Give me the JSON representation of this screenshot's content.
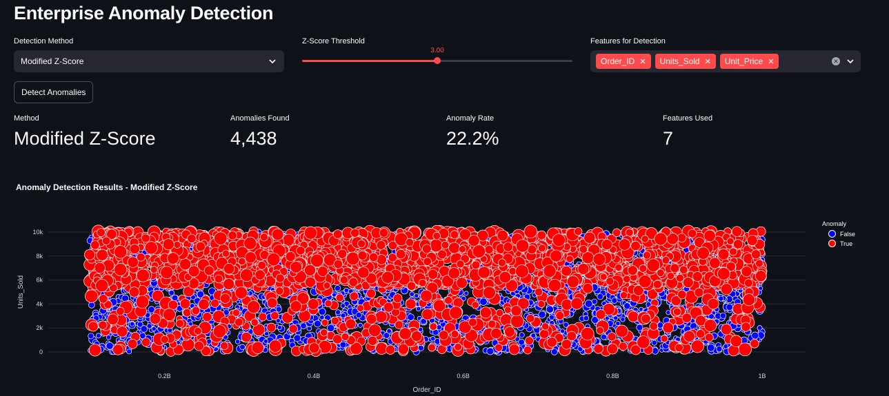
{
  "app": {
    "title": "Enterprise Anomaly Detection"
  },
  "controls": {
    "method_label": "Detection Method",
    "method_value": "Modified Z-Score",
    "threshold_label": "Z-Score Threshold",
    "threshold_value": "3.00",
    "threshold_fraction": 0.5,
    "features_label": "Features for Detection",
    "features": [
      "Order_ID",
      "Unit_Price",
      "Units_Sold"
    ],
    "features_shown": [
      "Order_ID",
      "Units_Sold",
      "Unit_Price"
    ],
    "detect_button": "Detect Anomalies"
  },
  "metrics": [
    {
      "label": "Method",
      "value": "Modified Z-Score"
    },
    {
      "label": "Anomalies Found",
      "value": "4,438"
    },
    {
      "label": "Anomaly Rate",
      "value": "22.2%"
    },
    {
      "label": "Features Used",
      "value": "7"
    }
  ],
  "colors": {
    "accent": "#ff4b4b",
    "false_color": "#0000ff",
    "true_color": "#ff0000",
    "background": "#0e1117"
  },
  "chart_data": {
    "type": "scatter",
    "title": "Anomaly Detection Results - Modified Z-Score",
    "xlabel": "Order_ID",
    "ylabel": "Units_Sold",
    "xlim": [
      100000000,
      1000000000
    ],
    "ylim": [
      0,
      10000
    ],
    "x_ticks": [
      {
        "value": 200000000,
        "label": "0.2B"
      },
      {
        "value": 400000000,
        "label": "0.4B"
      },
      {
        "value": 600000000,
        "label": "0.6B"
      },
      {
        "value": 800000000,
        "label": "0.8B"
      },
      {
        "value": 1000000000,
        "label": "1B"
      }
    ],
    "y_ticks": [
      {
        "value": 0,
        "label": "0"
      },
      {
        "value": 2000,
        "label": "2k"
      },
      {
        "value": 4000,
        "label": "4k"
      },
      {
        "value": 6000,
        "label": "6k"
      },
      {
        "value": 8000,
        "label": "8k"
      },
      {
        "value": 10000,
        "label": "10k"
      }
    ],
    "legend": {
      "title": "Anomaly",
      "position": "top-right",
      "entries": [
        "False",
        "True"
      ]
    },
    "series": [
      {
        "name": "False",
        "color": "#0000ff",
        "point_count_approx": 15562
      },
      {
        "name": "True",
        "color": "#ff0000",
        "point_count_approx": 4438
      }
    ]
  }
}
